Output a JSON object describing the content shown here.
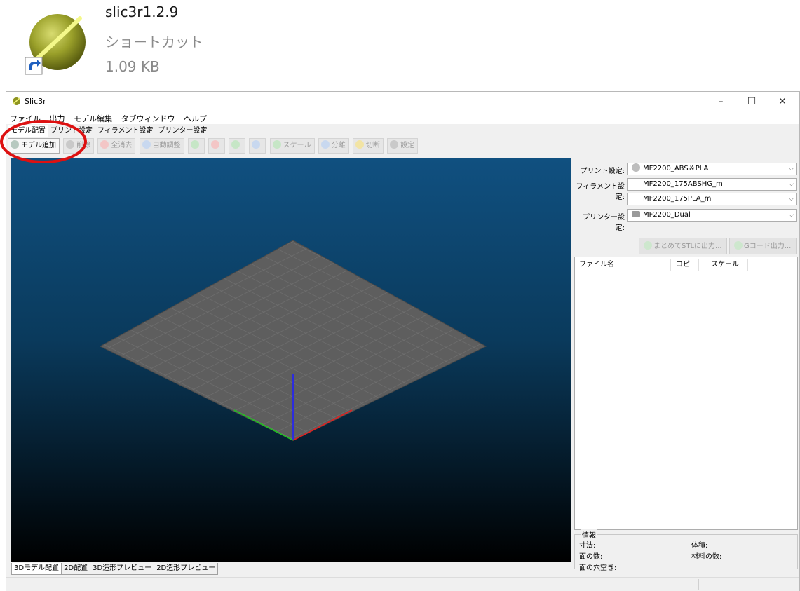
{
  "shortcut": {
    "name": "slic3r1.2.9",
    "type": "ショートカット",
    "size": "1.09 KB"
  },
  "window": {
    "title": "Slic3r",
    "minimize": "–",
    "maximize": "☐",
    "close": "✕"
  },
  "menu": [
    "ファイル",
    "出力",
    "モデル編集",
    "タブウィンドウ",
    "ヘルプ"
  ],
  "tabs": [
    "モデル配置",
    "プリント設定",
    "フィラメント設定",
    "プリンター設定"
  ],
  "toolbar": [
    "モデル追加",
    "削除",
    "全消去",
    "自動調整",
    "",
    "",
    "",
    "",
    "スケール",
    "分離",
    "切断",
    "設定"
  ],
  "bottom_tabs": [
    "3Dモデル配置",
    "2D配置",
    "3D造形プレビュー",
    "2D造形プレビュー"
  ],
  "panel": {
    "print_label": "プリント設定:",
    "print_value": "MF2200_ABS＆PLA",
    "filament_label": "フィラメント設定:",
    "filament_value_1": "MF2200_175ABSHG_m",
    "filament_value_2": "MF2200_175PLA_m",
    "printer_label": "プリンター設定:",
    "printer_value": "MF2200_Dual",
    "export_stl": "まとめてSTLに出力...",
    "export_gcode": "Gコード出力...",
    "list_headers": [
      "ファイル名",
      "コピ",
      "スケール"
    ],
    "info_title": "情報",
    "info": {
      "dimensions": "寸法:",
      "volume": "体積:",
      "facets": "面の数:",
      "materials": "材料の数:",
      "holes": "面の穴空き:"
    }
  },
  "colors": {
    "annotation": "#dd1111",
    "axis_x": "#e02020",
    "axis_y": "#20c020",
    "axis_z": "#2020ff",
    "bed": "#5e5e5e"
  },
  "icons": [
    "slic3r-logo-icon",
    "shortcut-arrow-icon",
    "combo-arrow-icon",
    "gear-icon",
    "printer-icon"
  ]
}
